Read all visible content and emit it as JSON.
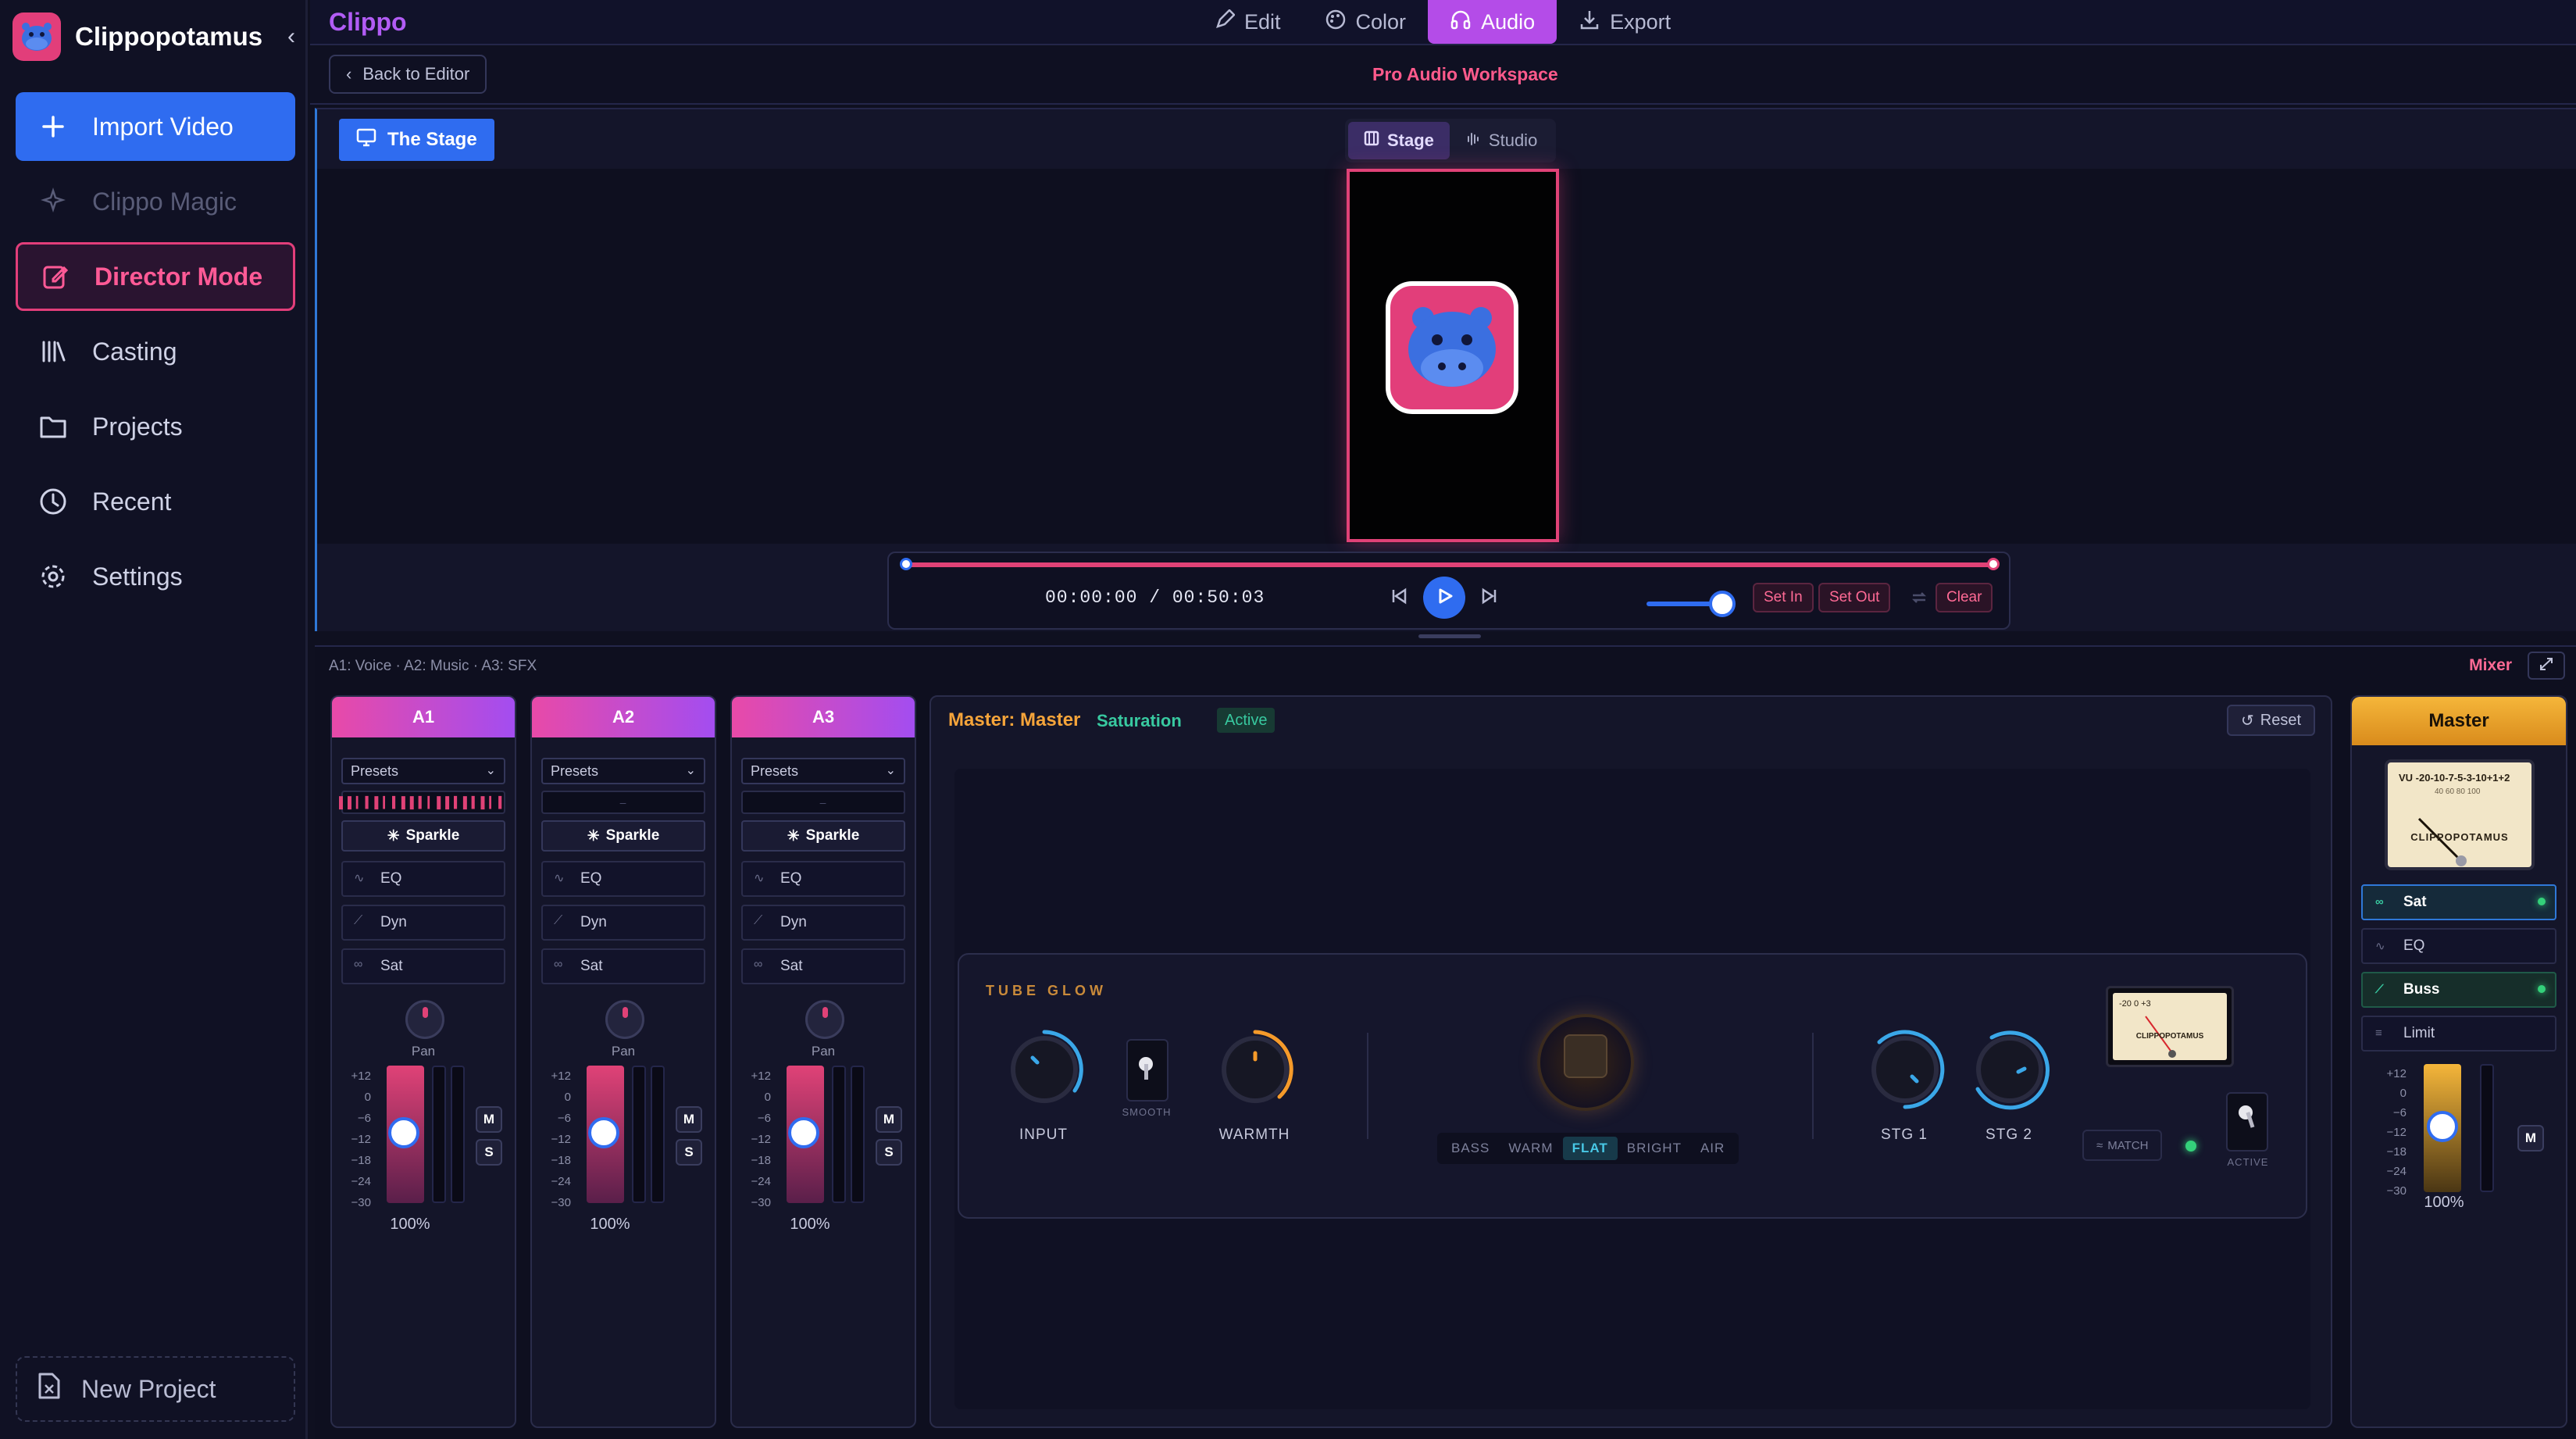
{
  "sidebar": {
    "brand": "Clippopotamus",
    "items": [
      {
        "label": "Import Video",
        "icon": "plus-icon"
      },
      {
        "label": "Clippo Magic",
        "icon": "sparkles-icon"
      },
      {
        "label": "Director Mode",
        "icon": "edit-icon"
      },
      {
        "label": "Casting",
        "icon": "library-icon"
      },
      {
        "label": "Projects",
        "icon": "folder-icon"
      },
      {
        "label": "Recent",
        "icon": "clock-icon"
      },
      {
        "label": "Settings",
        "icon": "gear-icon"
      }
    ],
    "new_project": "New Project"
  },
  "topbar": {
    "app_title": "Clippo",
    "tabs": [
      {
        "label": "Edit",
        "icon": "pencil-icon"
      },
      {
        "label": "Color",
        "icon": "palette-icon"
      },
      {
        "label": "Audio",
        "icon": "headphones-icon",
        "active": true
      },
      {
        "label": "Export",
        "icon": "download-icon"
      }
    ]
  },
  "subbar": {
    "back": "Back to Editor",
    "title": "Pro Audio Workspace"
  },
  "stage": {
    "tab": "The Stage",
    "toggle": [
      {
        "label": "Stage",
        "active": true
      },
      {
        "label": "Studio"
      }
    ]
  },
  "transport": {
    "timecode": "00:00:00 / 00:50:03",
    "progress": 0,
    "volume": 0.7,
    "set_in": "Set In",
    "set_out": "Set Out",
    "clear": "Clear"
  },
  "mixer": {
    "info": "A1: Voice · A2: Music · A3: SFX",
    "label": "Mixer",
    "channels": [
      {
        "name": "A1",
        "preset": "Presets",
        "wave": "▌▌▎▍▌▎▍▌▌▍▎▌▌▍▌▍▌▎▍",
        "sparkle": "Sparkle",
        "fx": [
          "EQ",
          "Dyn",
          "Sat"
        ],
        "pan": "Pan",
        "level": "100%",
        "mute": "M",
        "solo": "S"
      },
      {
        "name": "A2",
        "preset": "Presets",
        "wave": "–",
        "sparkle": "Sparkle",
        "fx": [
          "EQ",
          "Dyn",
          "Sat"
        ],
        "pan": "Pan",
        "level": "100%",
        "mute": "M",
        "solo": "S"
      },
      {
        "name": "A3",
        "preset": "Presets",
        "wave": "–",
        "sparkle": "Sparkle",
        "fx": [
          "EQ",
          "Dyn",
          "Sat"
        ],
        "pan": "Pan",
        "level": "100%",
        "mute": "M",
        "solo": "S"
      }
    ],
    "scale": [
      "+12",
      "0",
      "−6",
      "−12",
      "−18",
      "−24",
      "−30"
    ],
    "fx_panel": {
      "title": "Master: Master",
      "subtitle": "Saturation",
      "badge": "Active",
      "reset": "Reset",
      "tube_title": "TUBE GLOW",
      "input": "INPUT",
      "smooth": "SMOOTH",
      "warmth": "WARMTH",
      "tones": [
        "BASS",
        "WARM",
        "FLAT",
        "BRIGHT",
        "AIR"
      ],
      "active_tone": "FLAT",
      "stg1": "STG 1",
      "stg2": "STG 2",
      "match": "MATCH",
      "active": "ACTIVE",
      "vu_scale": "-20  0  +3",
      "vu_brand": "CLIPPOPOTAMUS"
    },
    "master": {
      "title": "Master",
      "vu_scale_main": "VU -20-10-7-5-3-10+1+2",
      "vu_scale_sub": "40  60  80  100",
      "vu_brand": "CLIPPOPOTAMUS",
      "fx": [
        {
          "label": "Sat",
          "on": true
        },
        {
          "label": "EQ",
          "on": false
        },
        {
          "label": "Buss",
          "on": true
        },
        {
          "label": "Limit",
          "on": false
        }
      ],
      "scale": [
        "+12",
        "0",
        "−6",
        "−12",
        "−18",
        "−24",
        "−30"
      ],
      "level": "100%",
      "mute": "M"
    }
  },
  "colors": {
    "accent_blue": "#2f6cf0",
    "accent_pink": "#e23e7a",
    "accent_purple": "#b44ce8",
    "accent_gold": "#f5b63a",
    "accent_teal": "#38c9a0"
  }
}
